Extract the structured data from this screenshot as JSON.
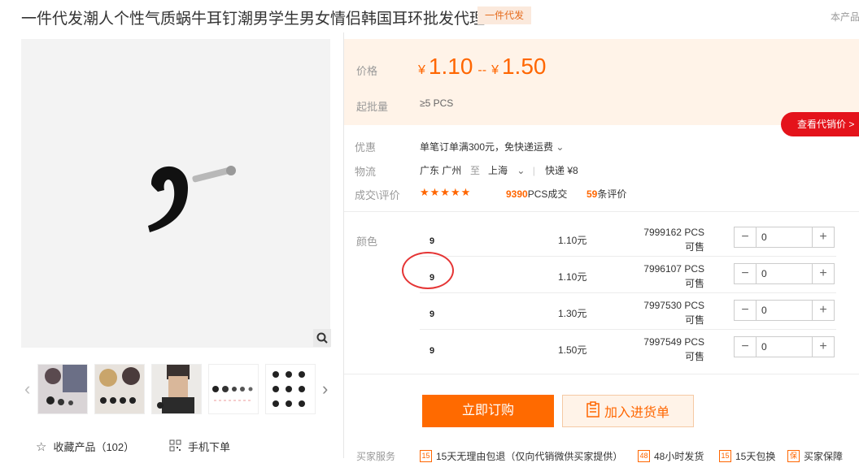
{
  "header": {
    "title": "一件代发潮人个性气质蜗牛耳钉潮男学生男女情侣韩国耳环批发代理",
    "badge": "一件代发",
    "right_link": "本产品"
  },
  "gallery": {
    "favorite_label": "收藏产品（102）",
    "mobile_label": "手机下单"
  },
  "price": {
    "label": "价格",
    "currency": "¥",
    "min": "1.10",
    "max": "1.50",
    "sep": "--",
    "moq_label": "起批量",
    "moq_value": "≥5  PCS",
    "agent_button": "查看代销价 >"
  },
  "promo": {
    "label": "优惠",
    "value": "单笔订单满300元，免快递运费"
  },
  "logistics": {
    "label": "物流",
    "from": "广东 广州",
    "to_word": "至",
    "to": "上海",
    "express": "快递 ¥8"
  },
  "deals": {
    "label": "成交\\评价",
    "stars": "★★★★★",
    "rating": 4.5,
    "count": "9390",
    "count_unit": "PCS成交",
    "reviews": "59",
    "reviews_unit": "条评价"
  },
  "sku": {
    "label": "颜色",
    "rows": [
      {
        "price": "1.10元",
        "stock": "7999162 PCS可售",
        "qty": "0"
      },
      {
        "price": "1.10元",
        "stock": "7996107 PCS可售",
        "qty": "0"
      },
      {
        "price": "1.30元",
        "stock": "7997530 PCS可售",
        "qty": "0"
      },
      {
        "price": "1.50元",
        "stock": "7997549 PCS可售",
        "qty": "0"
      }
    ]
  },
  "actions": {
    "buy": "立即订购",
    "cart": "加入进货单"
  },
  "services": {
    "label": "买家服务",
    "items": [
      "15天无理由包退（仅向代销微供买家提供）",
      "48小时发货",
      "15天包换",
      "买家保障"
    ]
  },
  "colors": {
    "accent": "#ff6600",
    "red": "#e4131b"
  }
}
